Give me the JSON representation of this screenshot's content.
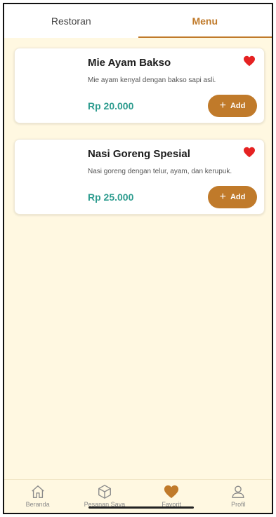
{
  "tabs": [
    {
      "label": "Restoran",
      "active": false
    },
    {
      "label": "Menu",
      "active": true
    }
  ],
  "items": [
    {
      "name": "Mie Ayam Bakso",
      "description": "Mie ayam kenyal dengan bakso sapi asli.",
      "price": "Rp 20.000",
      "add_label": "Add",
      "favorited": true
    },
    {
      "name": "Nasi Goreng Spesial",
      "description": "Nasi goreng dengan telur, ayam, dan kerupuk.",
      "price": "Rp 25.000",
      "add_label": "Add",
      "favorited": true
    }
  ],
  "nav": [
    {
      "label": "Beranda",
      "icon": "home-icon"
    },
    {
      "label": "Pesanan Saya",
      "icon": "box-icon"
    },
    {
      "label": "Favorit",
      "icon": "heart-icon",
      "active": true
    },
    {
      "label": "Profil",
      "icon": "user-icon"
    }
  ],
  "colors": {
    "accent": "#C07A2A",
    "price": "#2E9C8F",
    "heart": "#E52222",
    "background": "#FFF8E1"
  }
}
